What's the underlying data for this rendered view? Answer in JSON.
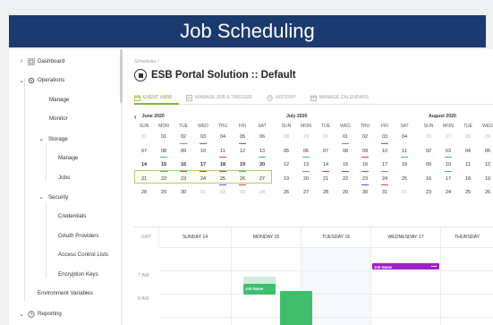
{
  "banner": {
    "title": "Job Scheduling"
  },
  "sidebar": {
    "items": [
      {
        "key": "dashboard",
        "label": "Dashboard",
        "chev": "›",
        "icon": "grid-icon"
      },
      {
        "key": "operations",
        "label": "Operations",
        "chev": "⌄",
        "icon": "gear-icon"
      },
      {
        "key": "manage",
        "label": "Manage"
      },
      {
        "key": "monitor",
        "label": "Monitor"
      },
      {
        "key": "storage",
        "label": "Storage",
        "chev": "⌄"
      },
      {
        "key": "storage-manage",
        "label": "Manage"
      },
      {
        "key": "jobs",
        "label": "Jobs"
      },
      {
        "key": "security",
        "label": "Security",
        "chev": "⌄"
      },
      {
        "key": "credentials",
        "label": "Credentials"
      },
      {
        "key": "oauth",
        "label": "OAuth Providers"
      },
      {
        "key": "acl",
        "label": "Access Control Lists"
      },
      {
        "key": "encryption",
        "label": "Encryption Keys"
      },
      {
        "key": "env",
        "label": "Environment Variables"
      },
      {
        "key": "reporting",
        "label": "Reporting",
        "chev": "⌄",
        "icon": "report-icon"
      }
    ]
  },
  "main": {
    "breadcrumb": "Scheduler /",
    "title": "ESB Portal Solution :: Default",
    "tabs": [
      {
        "label": "EVENT VIEW",
        "active": true,
        "icon": "calendar-icon"
      },
      {
        "label": "MANAGE JOB & TRIGGER",
        "active": false,
        "icon": "list-icon"
      },
      {
        "label": "HISTORY",
        "active": false,
        "icon": "history-icon"
      },
      {
        "label": "MANAGE CALENDARS",
        "active": false,
        "icon": "calendar-grid-icon"
      }
    ]
  },
  "calendar": {
    "dow": [
      "SUN",
      "MON",
      "TUE",
      "WED",
      "THU",
      "FRI",
      "SAT"
    ],
    "months": [
      {
        "name": "June 2020",
        "weeks": [
          [
            "31",
            "01",
            "02",
            "03",
            "04",
            "05",
            "06"
          ],
          [
            "07",
            "08",
            "09",
            "10",
            "11",
            "12",
            "13"
          ],
          [
            "14",
            "15",
            "16",
            "17",
            "18",
            "19",
            "20"
          ],
          [
            "21",
            "22",
            "23",
            "24",
            "25",
            "26",
            "27"
          ],
          [
            "28",
            "29",
            "30",
            "01",
            "02",
            "03",
            "04"
          ]
        ]
      },
      {
        "name": "July 2020",
        "weeks": [
          [
            "28",
            "29",
            "30",
            "01",
            "02",
            "03",
            "04"
          ],
          [
            "05",
            "06",
            "07",
            "08",
            "09",
            "10",
            "11"
          ],
          [
            "12",
            "13",
            "14",
            "15",
            "16",
            "17",
            "18"
          ],
          [
            "19",
            "20",
            "21",
            "22",
            "23",
            "24",
            "25"
          ],
          [
            "26",
            "27",
            "28",
            "29",
            "30",
            "31",
            "01"
          ]
        ]
      },
      {
        "name": "August 2020",
        "weeks": [
          [
            "26",
            "27",
            "28",
            "29",
            "30",
            "31",
            "01"
          ],
          [
            "02",
            "03",
            "04",
            "05",
            "06",
            "07",
            "08"
          ],
          [
            "09",
            "10",
            "11",
            "12",
            "13",
            "14",
            "15"
          ],
          [
            "16",
            "17",
            "18",
            "19",
            "20",
            "21",
            "22"
          ],
          [
            "23",
            "24",
            "25",
            "26",
            "27",
            "28",
            "29"
          ]
        ]
      }
    ]
  },
  "weekview": {
    "tz": "GMT",
    "days": [
      "SUNDAY 14",
      "MONDAY 15",
      "TUESDAY 16",
      "WEDNESDAY 17",
      "THURSDAY"
    ],
    "times": [
      "7 AM",
      "8 AM"
    ],
    "events": [
      {
        "label": "Job Name",
        "color": "#a020c8"
      },
      {
        "label": "Job Name",
        "color": "#3fbe6e"
      }
    ]
  },
  "colors": {
    "accent": "#8ab52b",
    "underline_red": "#e0443a",
    "underline_green": "#3fbe6e",
    "underline_purple": "#8a3fd1",
    "banner": "#1b3a6e"
  }
}
